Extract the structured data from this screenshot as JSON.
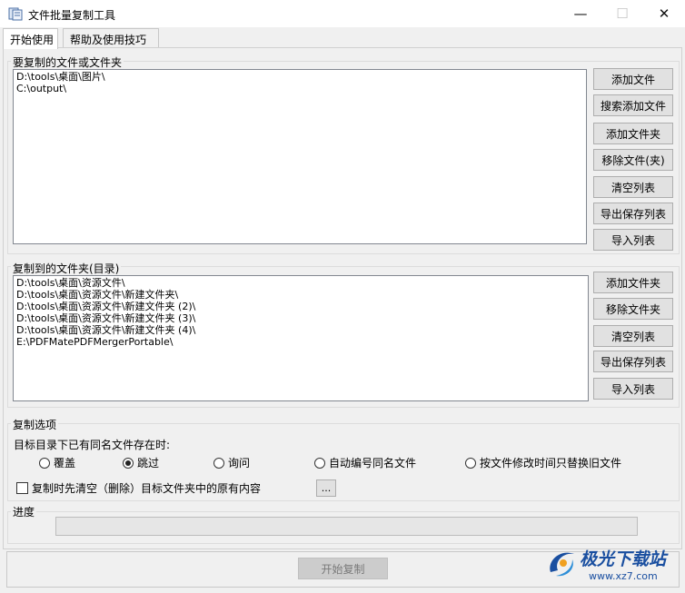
{
  "window": {
    "title": "文件批量复制工具",
    "minimize_glyph": "—",
    "maximize_glyph": "☐",
    "close_glyph": "✕"
  },
  "tabs": [
    {
      "label": "开始使用",
      "active": true
    },
    {
      "label": "帮助及使用技巧",
      "active": false
    }
  ],
  "source_group": {
    "label": "要复制的文件或文件夹",
    "items": [
      "D:\\tools\\桌面\\图片\\",
      "C:\\output\\"
    ],
    "buttons": {
      "add_file": "添加文件",
      "search_add_file": "搜索添加文件",
      "add_folder": "添加文件夹",
      "remove": "移除文件(夹)",
      "clear": "清空列表",
      "export": "导出保存列表",
      "import": "导入列表"
    }
  },
  "dest_group": {
    "label": "复制到的文件夹(目录)",
    "items": [
      "D:\\tools\\桌面\\资源文件\\",
      "D:\\tools\\桌面\\资源文件\\新建文件夹\\",
      "D:\\tools\\桌面\\资源文件\\新建文件夹 (2)\\",
      "D:\\tools\\桌面\\资源文件\\新建文件夹 (3)\\",
      "D:\\tools\\桌面\\资源文件\\新建文件夹 (4)\\",
      "E:\\PDFMatePDFMergerPortable\\"
    ],
    "buttons": {
      "add_folder": "添加文件夹",
      "remove_folder": "移除文件夹",
      "clear": "清空列表",
      "export": "导出保存列表",
      "import": "导入列表"
    }
  },
  "options": {
    "label": "复制选项",
    "conflict_prompt": "目标目录下已有同名文件存在时:",
    "radios": [
      {
        "label": "覆盖",
        "checked": false
      },
      {
        "label": "跳过",
        "checked": true
      },
      {
        "label": "询问",
        "checked": false
      },
      {
        "label": "自动编号同名文件",
        "checked": false
      },
      {
        "label": "按文件修改时间只替换旧文件",
        "checked": false
      }
    ],
    "clear_target_checkbox": {
      "label": "复制时先清空（删除）目标文件夹中的原有内容",
      "checked": false
    },
    "browse_button": "..."
  },
  "progress": {
    "label": "进度",
    "value": 0
  },
  "start_button": "开始复制",
  "watermark": {
    "brand": "极光下载站",
    "url": "www.xz7.com"
  }
}
